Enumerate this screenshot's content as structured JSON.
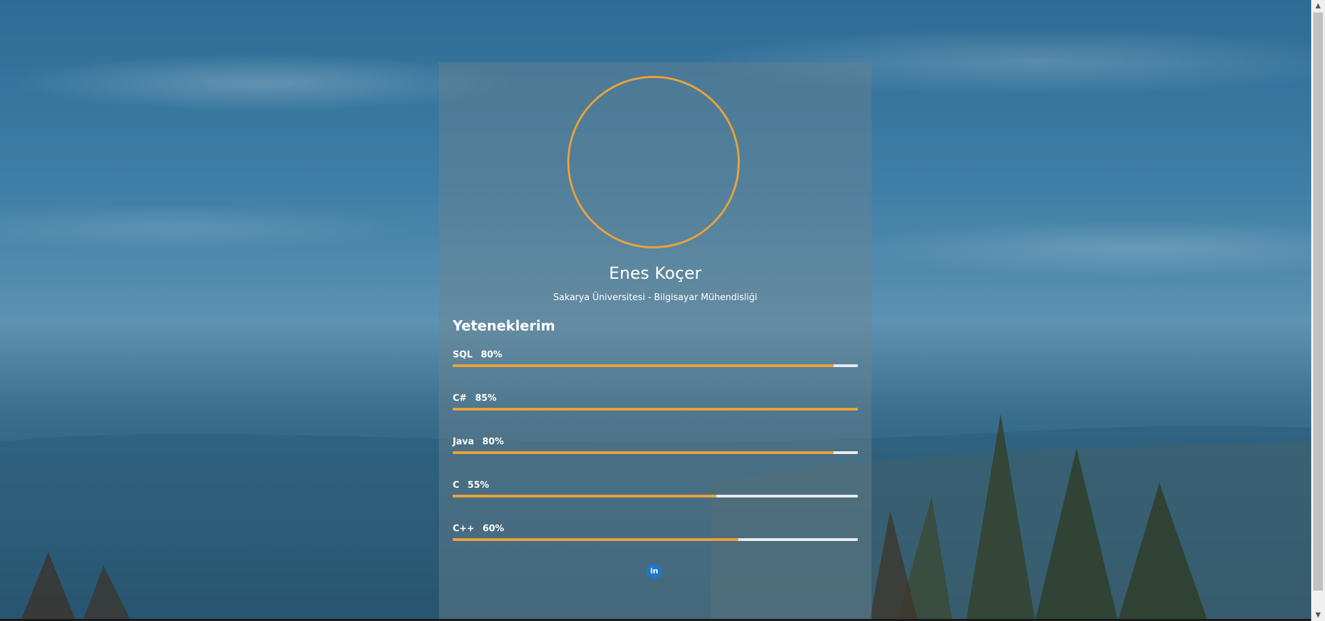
{
  "profile": {
    "name": "Enes Koçer",
    "subtitle": "Sakarya Üniversitesi - Bilgisayar Mühendisliği"
  },
  "skills_section": {
    "title": "Yeteneklerim",
    "items": [
      {
        "name": "SQL",
        "percent_label": "80%",
        "bar_fill": 0.94
      },
      {
        "name": "C#",
        "percent_label": "85%",
        "bar_fill": 1.0
      },
      {
        "name": "Java",
        "percent_label": "80%",
        "bar_fill": 0.94
      },
      {
        "name": "C",
        "percent_label": "55%",
        "bar_fill": 0.65
      },
      {
        "name": "C++",
        "percent_label": "60%",
        "bar_fill": 0.705
      }
    ]
  },
  "social": {
    "linkedin_glyph": "in",
    "linkedin_icon": "linkedin-icon"
  },
  "colors": {
    "accent": "#e9a23b",
    "bar_track": "#e8edf2",
    "linkedin": "#1f77c9"
  }
}
